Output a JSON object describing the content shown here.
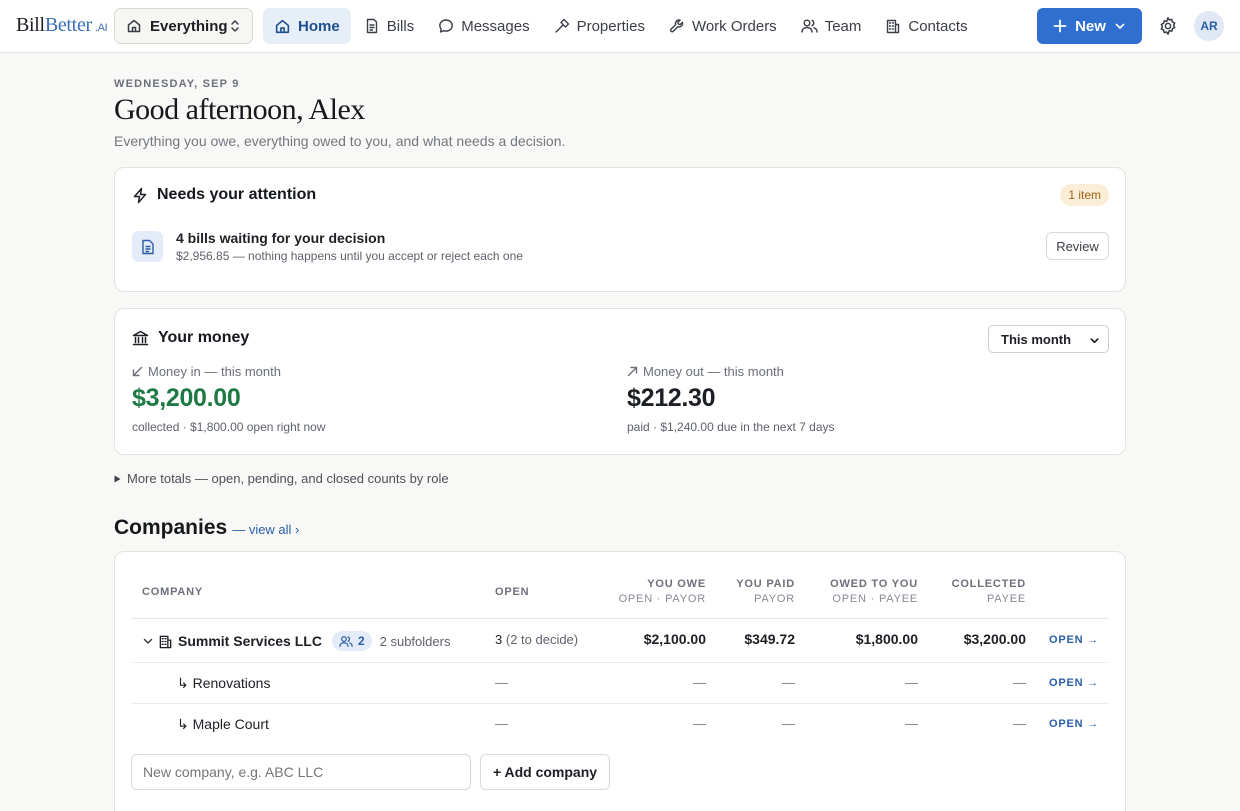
{
  "brand": {
    "part1": "Bill",
    "part2": "Better",
    "suffix": ".AI",
    "accent": "#3b6fb6"
  },
  "scope_selector": {
    "label": "Everything"
  },
  "nav": {
    "items": [
      {
        "label": "Home",
        "icon": "home-icon",
        "active": true
      },
      {
        "label": "Bills",
        "icon": "document-icon"
      },
      {
        "label": "Messages",
        "icon": "chat-icon"
      },
      {
        "label": "Properties",
        "icon": "hammer-icon"
      },
      {
        "label": "Work Orders",
        "icon": "wrench-icon"
      },
      {
        "label": "Team",
        "icon": "users-icon"
      },
      {
        "label": "Contacts",
        "icon": "building-icon"
      }
    ],
    "new_label": "New",
    "user_initials": "AR"
  },
  "header": {
    "date": "WEDNESDAY, SEP 9",
    "greeting": "Good afternoon, Alex",
    "subtitle": "Everything you owe, everything owed to you, and what needs a decision."
  },
  "attention": {
    "title": "Needs your attention",
    "badge": "1 item",
    "item_title": "4 bills waiting for your decision",
    "item_subtitle": "$2,956.85 — nothing happens until you accept or reject each one",
    "action": "Review"
  },
  "money": {
    "title": "Your money",
    "period": "This month",
    "in": {
      "label": "Money in — this month",
      "amount": "$3,200.00",
      "note": "collected · $1,800.00 open right now",
      "color": "#1e7a44"
    },
    "out": {
      "label": "Money out — this month",
      "amount": "$212.30",
      "note": "paid · $1,240.00 due in the next 7 days"
    }
  },
  "more_totals": "More totals — open, pending, and closed counts by role",
  "companies": {
    "title": "Companies",
    "view_all": "— view all ›",
    "columns": {
      "company": "COMPANY",
      "open": "OPEN",
      "you_owe": "YOU OWE",
      "you_owe_sub": "OPEN · PAYOR",
      "you_paid": "YOU PAID",
      "you_paid_sub": "PAYOR",
      "owed_to_you": "OWED TO YOU",
      "owed_to_you_sub": "OPEN · PAYEE",
      "collected": "COLLECTED",
      "collected_sub": "PAYEE"
    },
    "rows": [
      {
        "name": "Summit Services LLC",
        "members": "2",
        "subfolders": "2 subfolders",
        "open_count": "3",
        "open_note": "(2 to decide)",
        "you_owe": "$2,100.00",
        "you_paid": "$349.72",
        "owed_to_you": "$1,800.00",
        "collected": "$3,200.00",
        "action": "OPEN →"
      },
      {
        "name": "↳ Renovations",
        "open": "—",
        "you_owe": "—",
        "you_paid": "—",
        "owed_to_you": "—",
        "collected": "—",
        "action": "OPEN →"
      },
      {
        "name": "↳ Maple Court",
        "open": "—",
        "you_owe": "—",
        "you_paid": "—",
        "owed_to_you": "—",
        "collected": "—",
        "action": "OPEN →"
      }
    ],
    "new_placeholder": "New company, e.g. ABC LLC",
    "add_label": "+ Add company"
  }
}
